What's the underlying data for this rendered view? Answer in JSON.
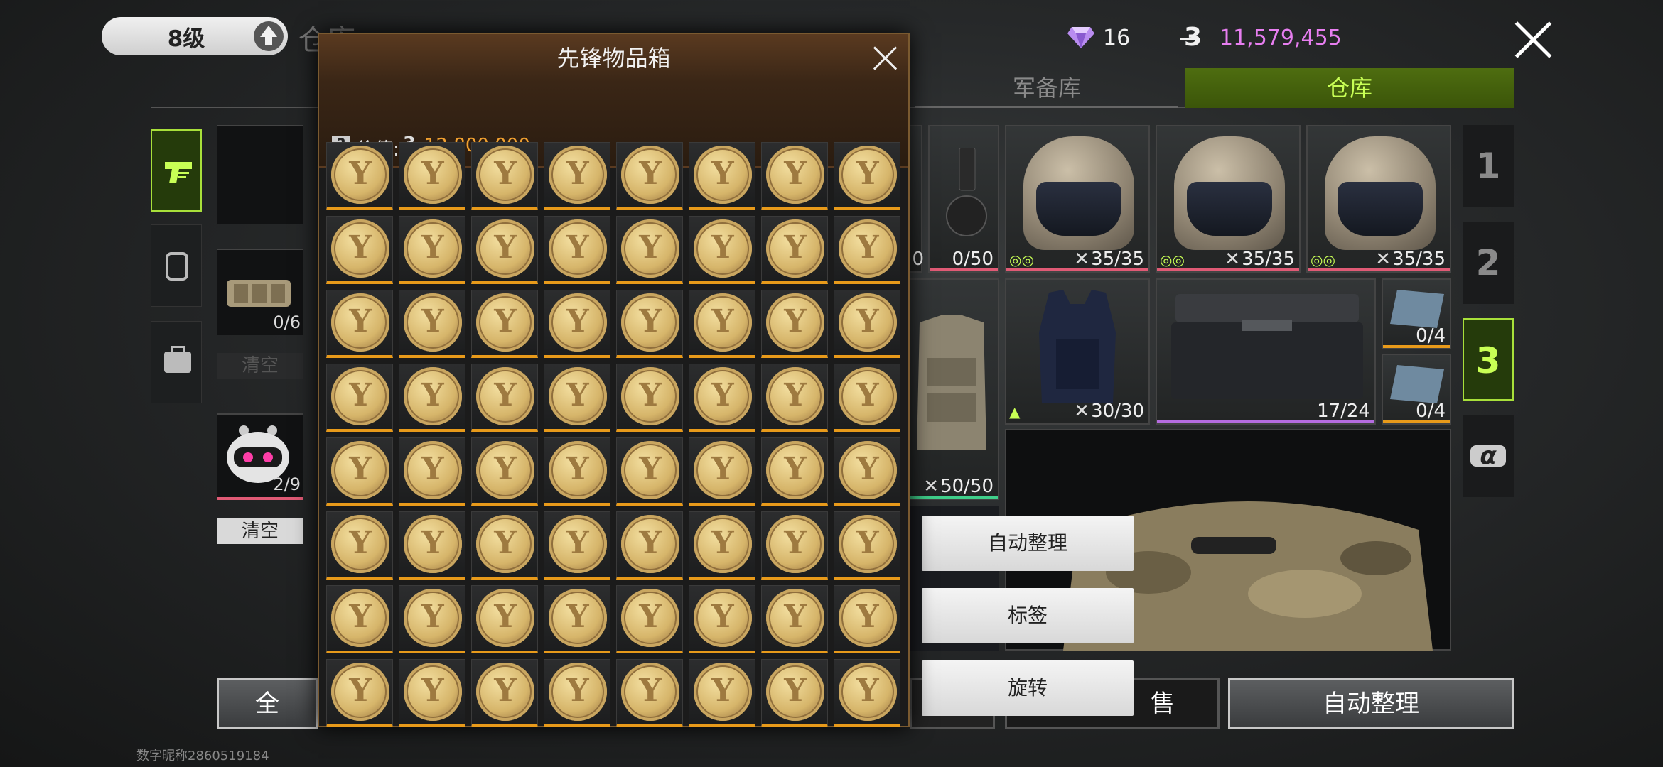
{
  "header": {
    "level": "8级",
    "background_title": "仓库",
    "gems": "16",
    "coin_symbol": "3̶",
    "coins": "11,579,455"
  },
  "tabs": [
    {
      "label": "军备库",
      "active": false
    },
    {
      "label": "仓库",
      "active": true
    }
  ],
  "left_panel": {
    "slot1_count": "0/6",
    "clear_dim": "清空",
    "slot2_count": "2/9",
    "clear": "清空"
  },
  "right_panel": {
    "mag_count": "0/50",
    "helmets": [
      {
        "durability": "35/35"
      },
      {
        "durability": "35/35"
      },
      {
        "durability": "35/35"
      }
    ],
    "vest_durability": "50/50",
    "armor_durability": "30/30",
    "case_count": "17/24",
    "plate1_count": "0/4",
    "plate2_count": "0/4",
    "number_tabs": [
      "1",
      "2",
      "3",
      "α"
    ],
    "partial_left": "0"
  },
  "modal": {
    "title": "先锋物品箱",
    "value_label": "价值:",
    "value_coin_symbol": "3̶",
    "value": "12,800,000",
    "item_icon": "gold-coin-icon",
    "rows": 8,
    "cols": 8
  },
  "context_menu": [
    "自动整理",
    "标签",
    "旋转"
  ],
  "bottom_buttons": {
    "left_partial": "全",
    "sell_partial": "售",
    "auto_sort": "自动整理"
  },
  "footer": "数字昵称2860519184",
  "colors": {
    "accent_green": "#c8ff55",
    "coin_pink": "#e77ef0",
    "value_orange": "#f0a030",
    "rarity_orange": "#e89a1a"
  }
}
